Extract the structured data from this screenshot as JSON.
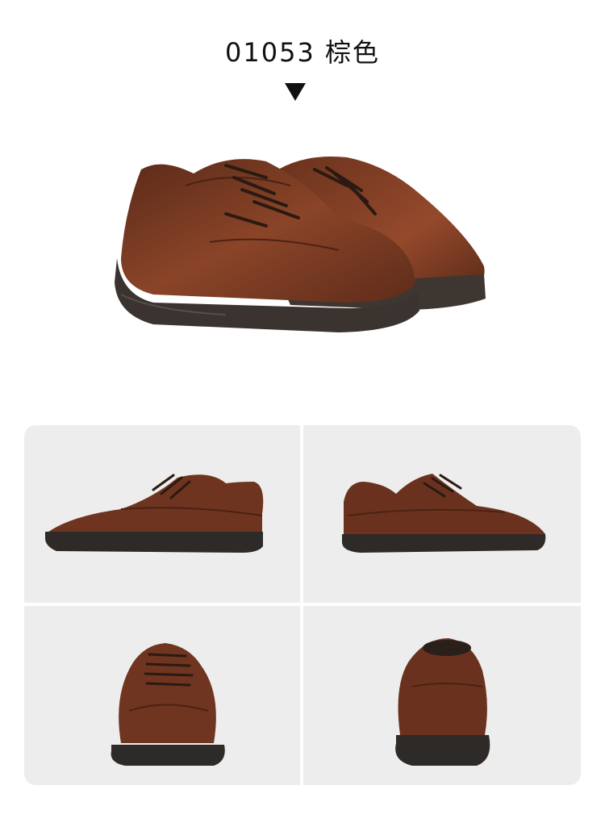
{
  "header": {
    "title": "01053 棕色"
  },
  "icons": {
    "arrow": "triangle-down-icon"
  },
  "colors": {
    "leather": "#7a3b22",
    "sole": "#3a332f",
    "panel": "#ededed"
  },
  "views": [
    "side-left",
    "side-right",
    "front",
    "back"
  ]
}
